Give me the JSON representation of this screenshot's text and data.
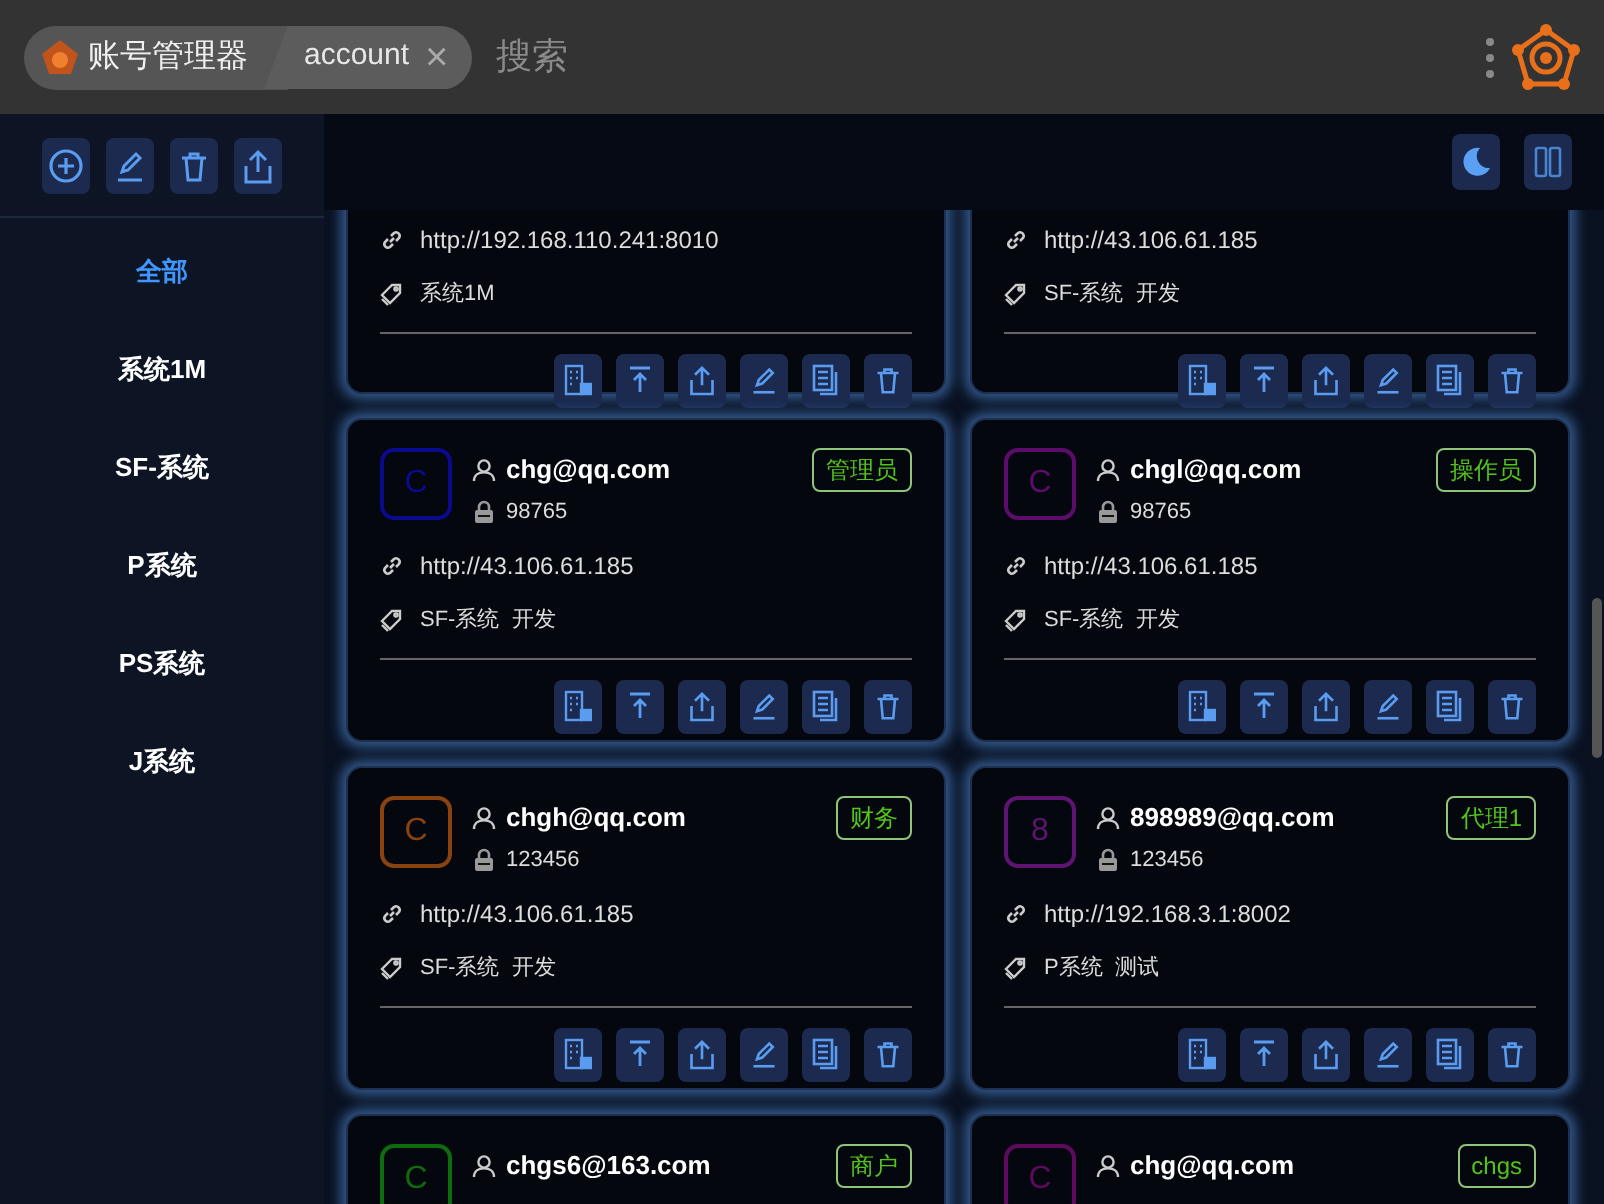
{
  "titlebar": {
    "app_name": "账号管理器",
    "tab": {
      "label": "account",
      "close": "×"
    },
    "search": {
      "placeholder": "搜索"
    }
  },
  "sidebar": {
    "items": [
      {
        "label": "全部",
        "selected": true
      },
      {
        "label": "系统1M",
        "selected": false
      },
      {
        "label": "SF-系统",
        "selected": false
      },
      {
        "label": "P系统",
        "selected": false
      },
      {
        "label": "PS系统",
        "selected": false
      },
      {
        "label": "J系统",
        "selected": false
      }
    ]
  },
  "cards": [
    {
      "url": "http://192.168.110.241:8010",
      "tags": "系统1M"
    },
    {
      "url": "http://43.106.61.185",
      "tags": "SF-系统  开发"
    },
    {
      "avatar": "C",
      "color": "#0a0a8c",
      "email": "chg@qq.com",
      "password": "98765",
      "role": "管理员",
      "url": "http://43.106.61.185",
      "tags": "SF-系统  开发"
    },
    {
      "avatar": "C",
      "color": "#5e0b6e",
      "email": "chgl@qq.com",
      "password": "98765",
      "role": "操作员",
      "url": "http://43.106.61.185",
      "tags": "SF-系统  开发"
    },
    {
      "avatar": "C",
      "color": "#8a4310",
      "email": "chgh@qq.com",
      "password": "123456",
      "role": "财务",
      "url": "http://43.106.61.185",
      "tags": "SF-系统  开发"
    },
    {
      "avatar": "8",
      "color": "#5e1470",
      "email": "898989@qq.com",
      "password": "123456",
      "role": "代理1",
      "url": "http://192.168.3.1:8002",
      "tags": "P系统  测试"
    },
    {
      "avatar": "C",
      "color": "#0e6b0e",
      "email": "chgs6@163.com",
      "role": "商户"
    },
    {
      "avatar": "C",
      "color": "#5e0b5e",
      "email": "chg@qq.com",
      "role": "chgs"
    }
  ]
}
